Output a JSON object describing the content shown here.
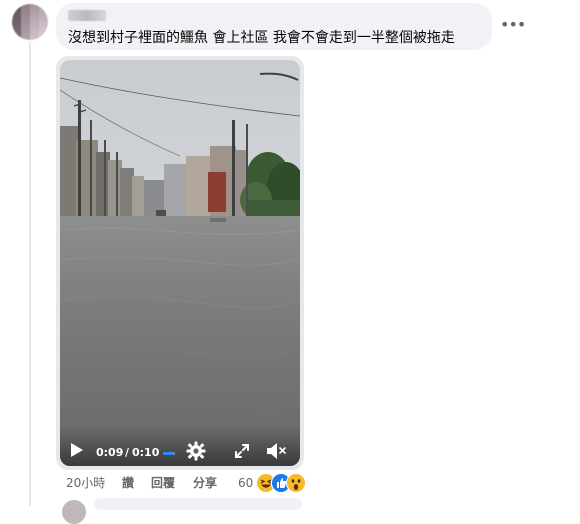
{
  "comment": {
    "text": "沒想到村子裡面的鱷魚 會上社區 我會不會走到一半整個被拖走",
    "more_icon": "more-horizontal-icon"
  },
  "video": {
    "current_time": "0:09",
    "separator": "/",
    "duration": "0:10",
    "progress": 0.9,
    "icons": [
      "play-icon",
      "settings-gear-icon",
      "fullscreen-icon",
      "mute-icon"
    ]
  },
  "footer": {
    "time": "20小時",
    "like": "讚",
    "reply": "回覆",
    "share": "分享",
    "reaction_count": "60",
    "reaction_icons": [
      "haha-icon",
      "like-icon",
      "wow-icon"
    ]
  },
  "colors": {
    "bubble": "#f0f2f5",
    "meta_text": "#65676b",
    "like_blue": "#1877f2",
    "haha_yellow": "#f7b928"
  }
}
